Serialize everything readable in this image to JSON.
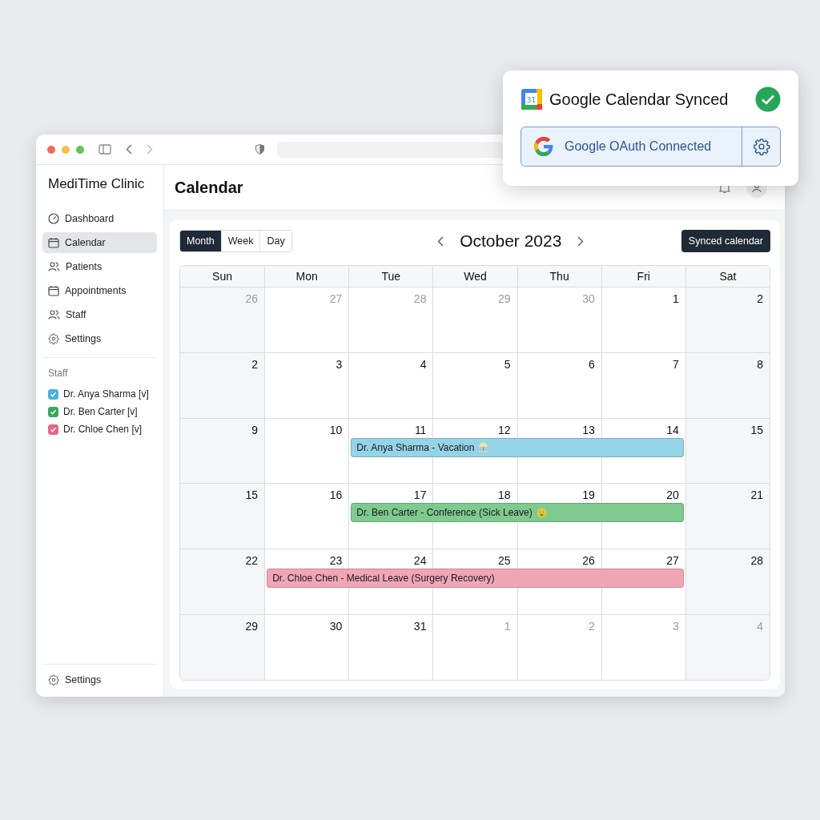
{
  "sidebar": {
    "brand": "MediTime Clinic",
    "nav": [
      {
        "label": "Dashboard",
        "kind": "gauge",
        "selected": false
      },
      {
        "label": "Calendar",
        "kind": "calendar",
        "selected": true
      },
      {
        "label": "Patients",
        "kind": "users",
        "selected": false
      },
      {
        "label": "Appointments",
        "kind": "calendar",
        "selected": false
      },
      {
        "label": "Staff",
        "kind": "users",
        "selected": false
      },
      {
        "label": "Settings",
        "kind": "gear",
        "selected": false
      }
    ],
    "staff_heading": "Staff",
    "staff": [
      {
        "label": "Dr. Anya Sharma [v]",
        "color": "#4ab3d9",
        "checked": true
      },
      {
        "label": "Dr. Ben Carter [v]",
        "color": "#3aa55c",
        "checked": true
      },
      {
        "label": "Dr. Chloe Chen [v]",
        "color": "#e06a8a",
        "checked": true
      }
    ],
    "footer_item": "Settings"
  },
  "header": {
    "title": "Calendar"
  },
  "calendar": {
    "views": [
      {
        "label": "Month",
        "selected": true
      },
      {
        "label": "Week",
        "selected": false
      },
      {
        "label": "Day",
        "selected": false
      }
    ],
    "month": "October 2023",
    "sync_button": "Synced calendar",
    "weekdays": [
      "Sun",
      "Mon",
      "Tue",
      "Wed",
      "Thu",
      "Fri",
      "Sat"
    ],
    "weeks": [
      {
        "days": [
          {
            "day": "26",
            "muted": true
          },
          {
            "day": "27",
            "muted": true
          },
          {
            "day": "28",
            "muted": true
          },
          {
            "day": "29",
            "muted": true
          },
          {
            "day": "30",
            "muted": true
          },
          {
            "day": "1",
            "muted": false
          },
          {
            "day": "2",
            "muted": false
          }
        ]
      },
      {
        "days": [
          {
            "day": "2",
            "muted": false
          },
          {
            "day": "3",
            "muted": false
          },
          {
            "day": "4",
            "muted": false
          },
          {
            "day": "5",
            "muted": false
          },
          {
            "day": "6",
            "muted": false
          },
          {
            "day": "7",
            "muted": false
          },
          {
            "day": "8",
            "muted": false
          }
        ]
      },
      {
        "days": [
          {
            "day": "9",
            "muted": false
          },
          {
            "day": "10",
            "muted": false
          },
          {
            "day": "11",
            "muted": false
          },
          {
            "day": "12",
            "muted": false
          },
          {
            "day": "13",
            "muted": false
          },
          {
            "day": "14",
            "muted": false
          },
          {
            "day": "15",
            "muted": false
          }
        ],
        "events": [
          {
            "label": "Dr. Anya Sharma - Vacation",
            "kind": "vacation",
            "color": "#95d4e6",
            "covers": [
              false,
              false,
              true,
              true,
              true,
              true,
              false
            ]
          }
        ]
      },
      {
        "days": [
          {
            "day": "15",
            "muted": false
          },
          {
            "day": "16",
            "muted": false
          },
          {
            "day": "17",
            "muted": false
          },
          {
            "day": "18",
            "muted": false
          },
          {
            "day": "19",
            "muted": false
          },
          {
            "day": "20",
            "muted": false
          },
          {
            "day": "21",
            "muted": false
          }
        ],
        "events": [
          {
            "label": "Dr. Ben Carter - Conference (Sick Leave)",
            "kind": "sick",
            "color": "#7fca8f",
            "covers": [
              false,
              false,
              true,
              true,
              true,
              true,
              false
            ]
          }
        ]
      },
      {
        "days": [
          {
            "day": "22",
            "muted": false
          },
          {
            "day": "23",
            "muted": false
          },
          {
            "day": "24",
            "muted": false
          },
          {
            "day": "25",
            "muted": false
          },
          {
            "day": "26",
            "muted": false
          },
          {
            "day": "27",
            "muted": false
          },
          {
            "day": "28",
            "muted": false
          }
        ],
        "events": [
          {
            "label": "Dr. Chloe Chen - Medical Leave (Surgery Recovery)",
            "kind": "plain",
            "color": "#f1a6b6",
            "covers": [
              false,
              true,
              true,
              true,
              true,
              true,
              false
            ]
          }
        ]
      },
      {
        "days": [
          {
            "day": "29",
            "muted": false
          },
          {
            "day": "30",
            "muted": false
          },
          {
            "day": "31",
            "muted": false
          },
          {
            "day": "1",
            "muted": true
          },
          {
            "day": "2",
            "muted": true
          },
          {
            "day": "3",
            "muted": true
          },
          {
            "day": "4",
            "muted": true
          }
        ]
      }
    ]
  },
  "popup": {
    "app_icon_text": "31",
    "title": "Google Calendar Synced",
    "synced": true,
    "oauth_button": "Google OAuth Connected"
  }
}
